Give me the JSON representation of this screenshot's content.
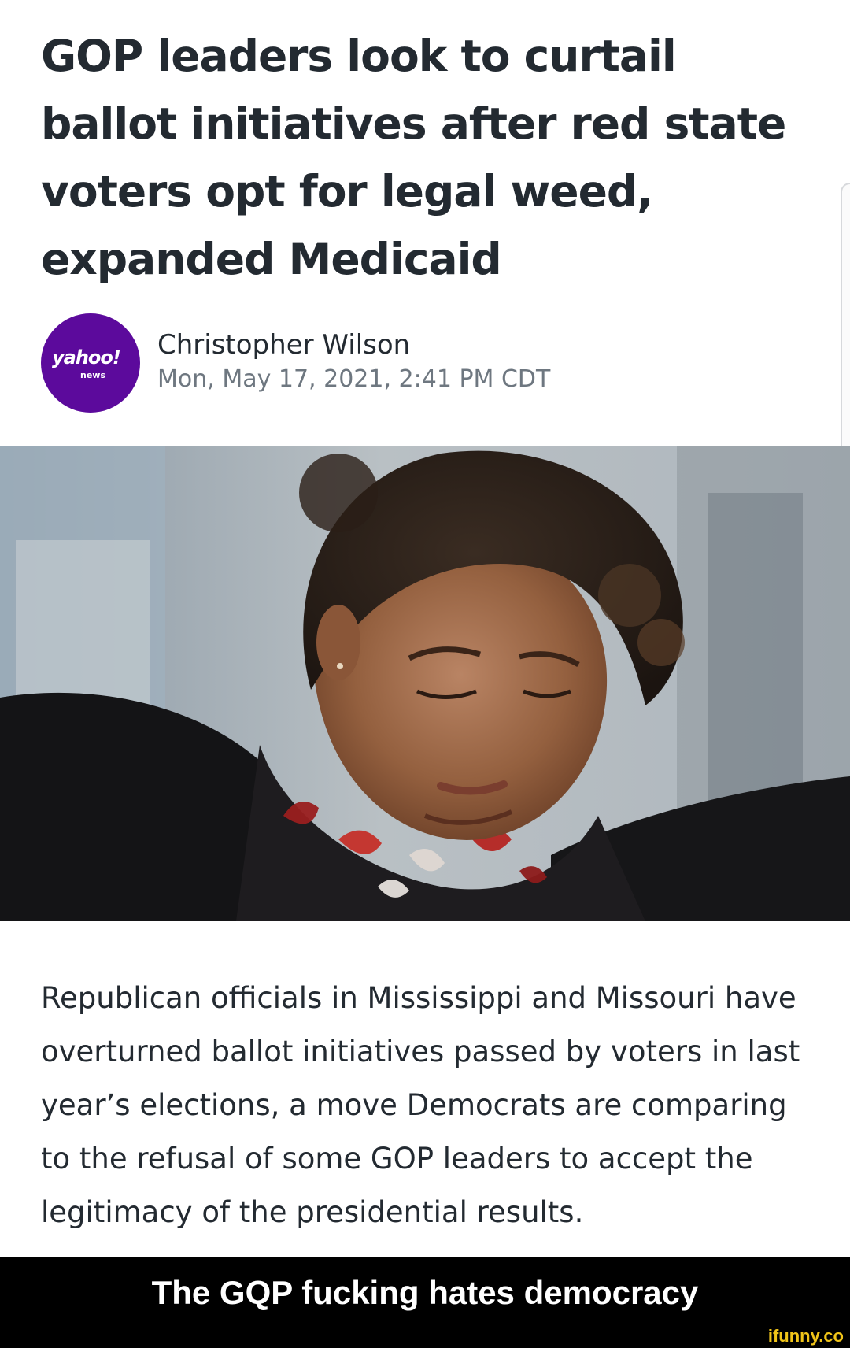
{
  "article": {
    "headline": "GOP leaders look to curtail ballot initiatives after red state voters opt for legal weed, expanded Medicaid",
    "publisher_logo": {
      "brand": "yahoo!",
      "sub": "news",
      "color": "#5c0a9c"
    },
    "author": "Christopher Wilson",
    "date": "Mon, May 17, 2021, 2:41 PM CDT",
    "hero_image": "photo of a woman with curly hair looking down",
    "summary": "Republican officials in Mississippi and Missouri have overturned ballot initiatives passed by voters in last year’s elections, a move Democrats are comparing to the refusal of some GOP leaders to accept the legitimacy of the presidential results."
  },
  "meme": {
    "caption": "The GQP fucking hates democracy",
    "watermark": "ifunny.co"
  },
  "colors": {
    "text": "#232a31",
    "muted": "#6e7780",
    "caption_bg": "#000000",
    "watermark": "#f0c419"
  }
}
